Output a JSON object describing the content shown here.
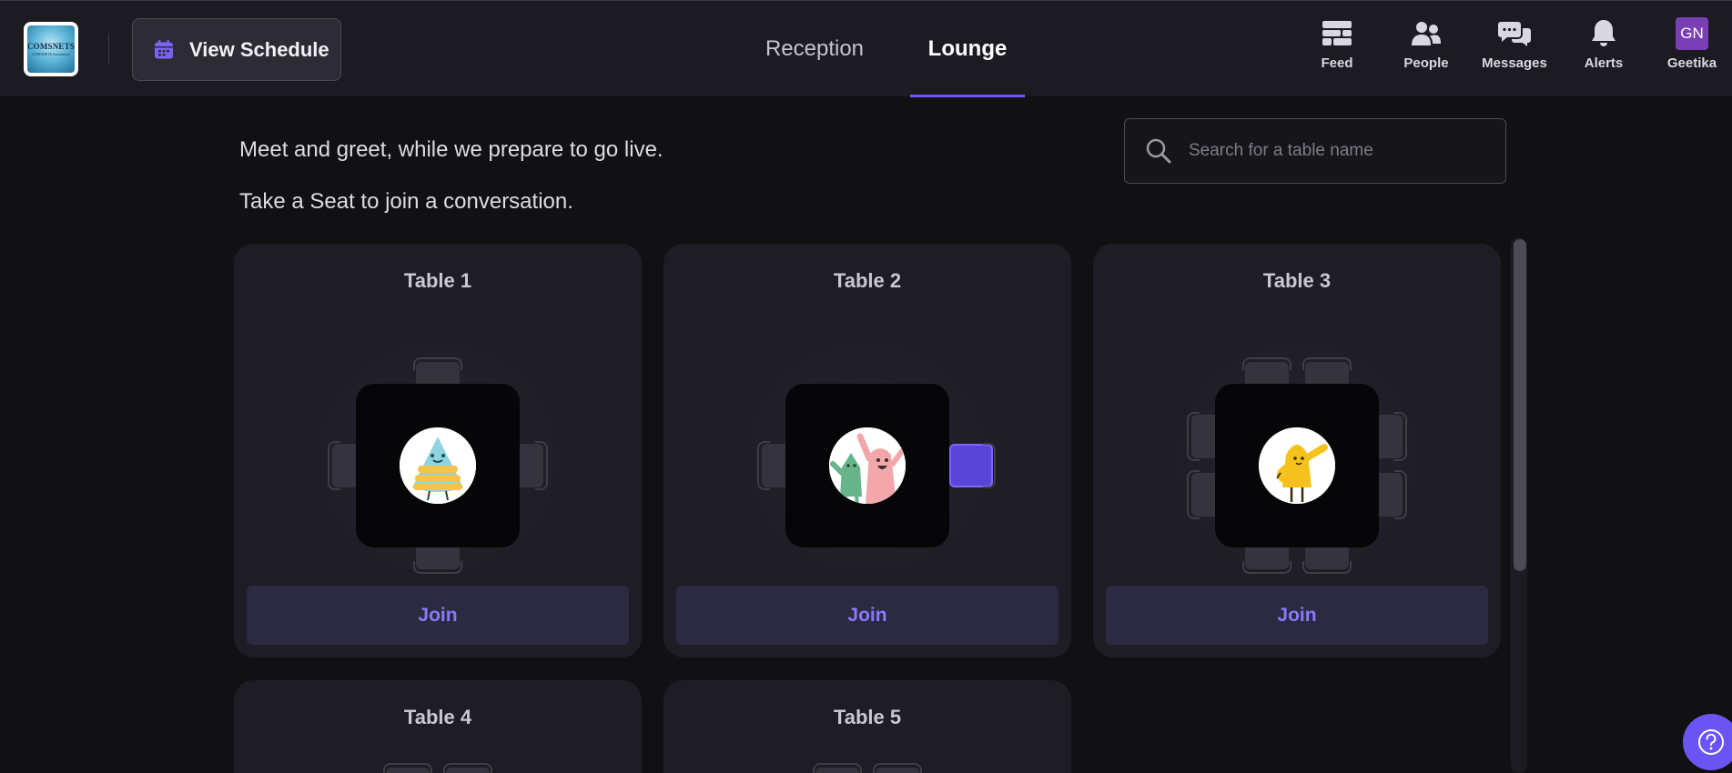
{
  "header": {
    "logo_text": "COMSNETS",
    "logo_subtext": "COMSNETS Association",
    "schedule_button": "View Schedule",
    "tabs": [
      {
        "label": "Reception",
        "active": false
      },
      {
        "label": "Lounge",
        "active": true
      }
    ],
    "nav": {
      "feed": "Feed",
      "people": "People",
      "messages": "Messages",
      "alerts": "Alerts",
      "profile_initials": "GN",
      "profile_name": "Geetika"
    },
    "accent_color": "#6e56f0"
  },
  "lounge": {
    "intro_line1": "Meet and greet, while we prepare to go live.",
    "intro_line2": "Take a Seat to join a conversation.",
    "search_placeholder": "Search for a table name",
    "tables": [
      {
        "name": "Table 1",
        "join_label": "Join",
        "seats": 4,
        "occupied_seats": 0,
        "emblem": "cake-character-icon"
      },
      {
        "name": "Table 2",
        "join_label": "Join",
        "seats": 2,
        "occupied_seats": 1,
        "emblem": "waving-friends-icon"
      },
      {
        "name": "Table 3",
        "join_label": "Join",
        "seats": 8,
        "occupied_seats": 0,
        "emblem": "yellow-waving-character-icon"
      },
      {
        "name": "Table 4"
      },
      {
        "name": "Table 5"
      }
    ]
  },
  "help_icon": "help-icon"
}
